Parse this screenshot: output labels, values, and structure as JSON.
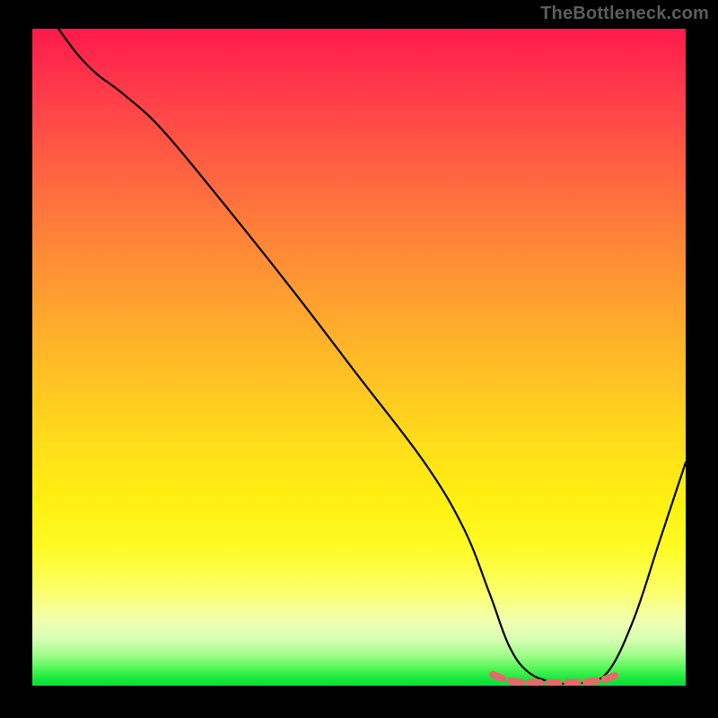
{
  "watermark": "TheBottleneck.com",
  "chart_data": {
    "type": "line",
    "title": "",
    "xlabel": "",
    "ylabel": "",
    "xlim": [
      0,
      100
    ],
    "ylim": [
      0,
      100
    ],
    "grid": false,
    "legend": false,
    "series": [
      {
        "name": "bottleneck-curve",
        "color": "#000000",
        "x": [
          4,
          7,
          10,
          14,
          20,
          30,
          40,
          50,
          60,
          66,
          70,
          73,
          76,
          80,
          84,
          88,
          92,
          96,
          100
        ],
        "values": [
          100,
          96,
          93,
          90,
          84.5,
          72.5,
          60,
          47,
          34,
          24,
          14,
          6,
          2,
          0.5,
          0.4,
          2,
          10,
          22,
          34
        ]
      },
      {
        "name": "optimal-band",
        "color": "#e46a6a",
        "x": [
          70.5,
          72.5,
          74,
          76,
          78.5,
          81,
          83.5,
          86,
          88,
          89.5
        ],
        "values": [
          1.7,
          0.9,
          0.6,
          0.5,
          0.45,
          0.45,
          0.5,
          0.7,
          1.1,
          1.7
        ]
      }
    ],
    "gradient_stops": [
      {
        "pos": 0,
        "color": "#ff1a4b"
      },
      {
        "pos": 24,
        "color": "#ff6a3f"
      },
      {
        "pos": 54,
        "color": "#ffc423"
      },
      {
        "pos": 79,
        "color": "#fffb25"
      },
      {
        "pos": 93,
        "color": "#d6ffb4"
      },
      {
        "pos": 100,
        "color": "#0fdc3a"
      }
    ]
  }
}
